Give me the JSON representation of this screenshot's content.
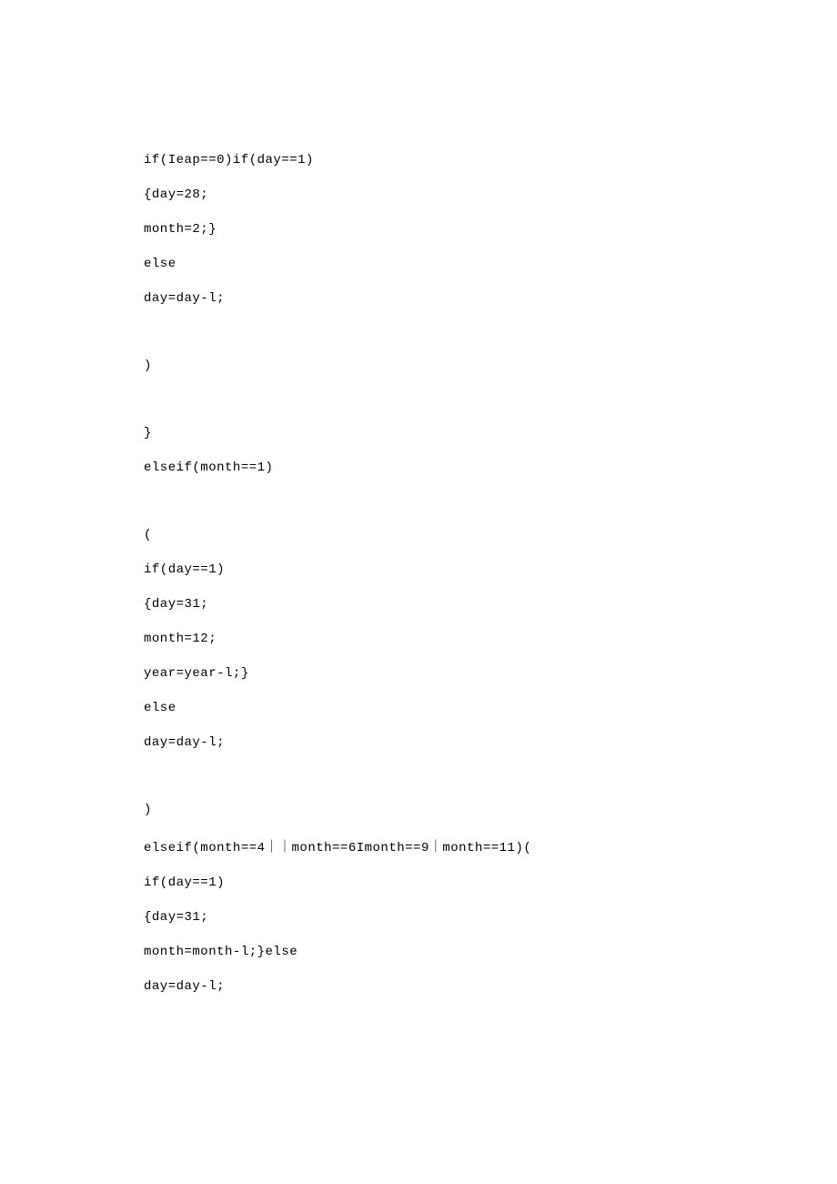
{
  "code": {
    "lines": [
      "if(Ieap==0)if(day==1)",
      "{day=28;",
      "month=2;}",
      "else",
      "day=day-l;",
      "",
      ")",
      "",
      "}",
      "elseif(month==1)",
      "",
      "(",
      "if(day==1)",
      "{day=31;",
      "month=12;",
      "year=year-l;}",
      "else",
      "day=day-l;",
      "",
      ")",
      "elseif(month==4｜｜month==6Imonth==9｜month==11)(",
      "if(day==1)",
      "{day=31;",
      "month=month-l;}else",
      "day=day-l;"
    ]
  }
}
